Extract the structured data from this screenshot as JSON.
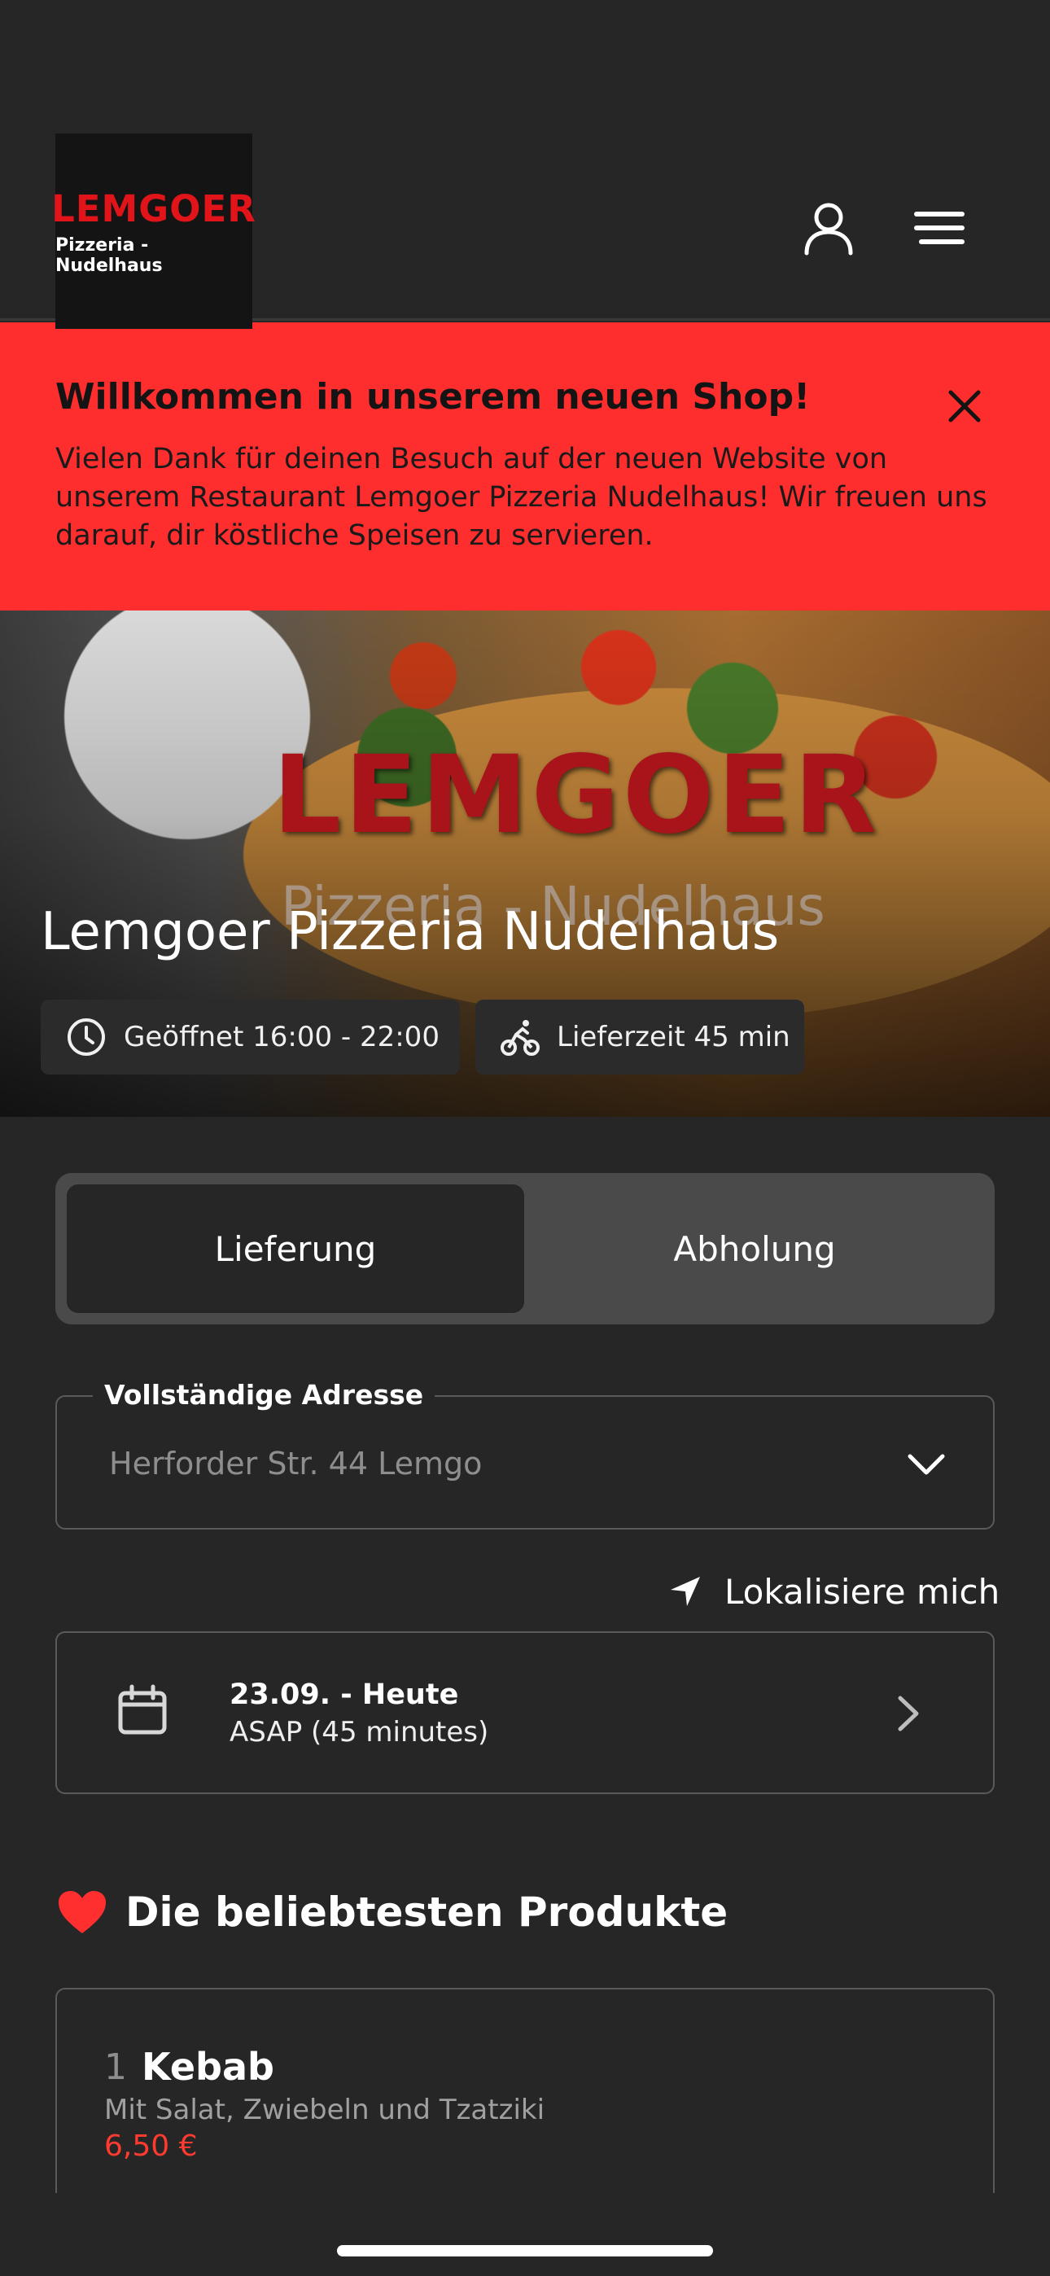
{
  "header": {
    "logo_brand": "LEMGOER",
    "logo_sub": "Pizzeria - Nudelhaus",
    "user_icon": "user-icon",
    "menu_icon": "menu-icon"
  },
  "banner": {
    "title": "Willkommen in unserem neuen Shop!",
    "text": "Vielen Dank für deinen Besuch auf der neuen Website von unserem Restaurant Lemgoer Pizzeria Nudelhaus! Wir freuen uns darauf, dir köstliche Speisen zu servieren.",
    "background": "#ff2e2e"
  },
  "hero": {
    "brand": "LEMGOER",
    "brand_sub": "Pizzeria - Nudelhaus",
    "title": "Lemgoer Pizzeria Nudelhaus",
    "opening_hours": "Geöffnet 16:00 - 22:00",
    "delivery_time": "Lieferzeit 45 min"
  },
  "order_mode": {
    "options": [
      "Lieferung",
      "Abholung"
    ],
    "selected": "Lieferung"
  },
  "address": {
    "label": "Vollständige Adresse",
    "placeholder": "Herforder Str. 44 Lemgo"
  },
  "locate_label": "Lokalisiere mich",
  "schedule": {
    "date": "23.09. - Heute",
    "time": "ASAP (45 minutes)"
  },
  "popular": {
    "title": "Die beliebtesten Produkte",
    "products": [
      {
        "rank": "1",
        "name": "Kebab",
        "description": "Mit Salat, Zwiebeln und Tzatziki",
        "price": "6,50 €"
      }
    ]
  },
  "colors": {
    "background": "#262627",
    "accent_red": "#ff3b30"
  }
}
